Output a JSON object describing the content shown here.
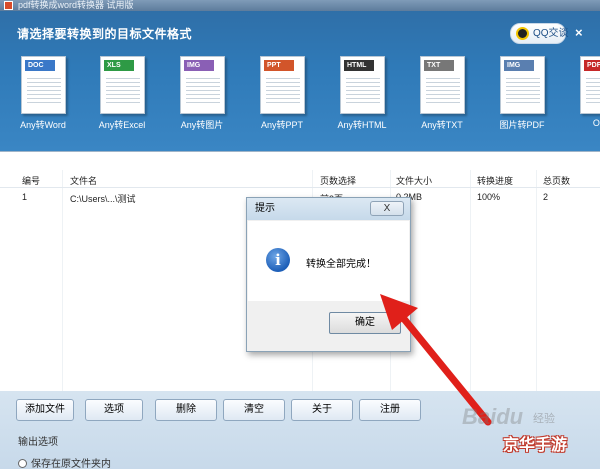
{
  "window": {
    "title": "pdf转换成word转换器 试用版"
  },
  "banner": {
    "prompt": "请选择要转换到的目标文件格式",
    "qq_label": "QQ交谈",
    "close_label": "×"
  },
  "formats": [
    {
      "tag": "DOC",
      "label": "Any转Word",
      "color": "#3a78c8"
    },
    {
      "tag": "XLS",
      "label": "Any转Excel",
      "color": "#2e9a45"
    },
    {
      "tag": "IMG",
      "label": "Any转图片",
      "color": "#8a5fb5"
    },
    {
      "tag": "PPT",
      "label": "Any转PPT",
      "color": "#d2552a"
    },
    {
      "tag": "HTML",
      "label": "Any转HTML",
      "color": "#333333"
    },
    {
      "tag": "TXT",
      "label": "Any转TXT",
      "color": "#777777"
    },
    {
      "tag": "IMG",
      "label": "图片转PDF",
      "color": "#5a7fb0"
    },
    {
      "tag": "PDF",
      "label": "Offic",
      "color": "#c62828"
    }
  ],
  "table": {
    "headers": [
      "编号",
      "文件名",
      "页数选择",
      "文件大小",
      "转换进度",
      "总页数"
    ],
    "rows": [
      {
        "id": "1",
        "name": "C:\\Users\\...\\测试",
        "pages": "前3页",
        "size": "0.2MB",
        "progress": "100%",
        "total": "2"
      }
    ]
  },
  "dialog": {
    "title": "提示",
    "close_label": "X",
    "message": "转换全部完成！",
    "ok_label": "确定"
  },
  "actions": {
    "add_file": "添加文件",
    "options": "选项",
    "delete": "删除",
    "clear": "清空",
    "about": "关于",
    "register": "注册"
  },
  "output": {
    "label": "输出选项",
    "save_option": "保存在原文件夹内"
  },
  "watermarks": {
    "baidu": "Baidu",
    "jingyan": "经验",
    "site": "京华手游"
  }
}
